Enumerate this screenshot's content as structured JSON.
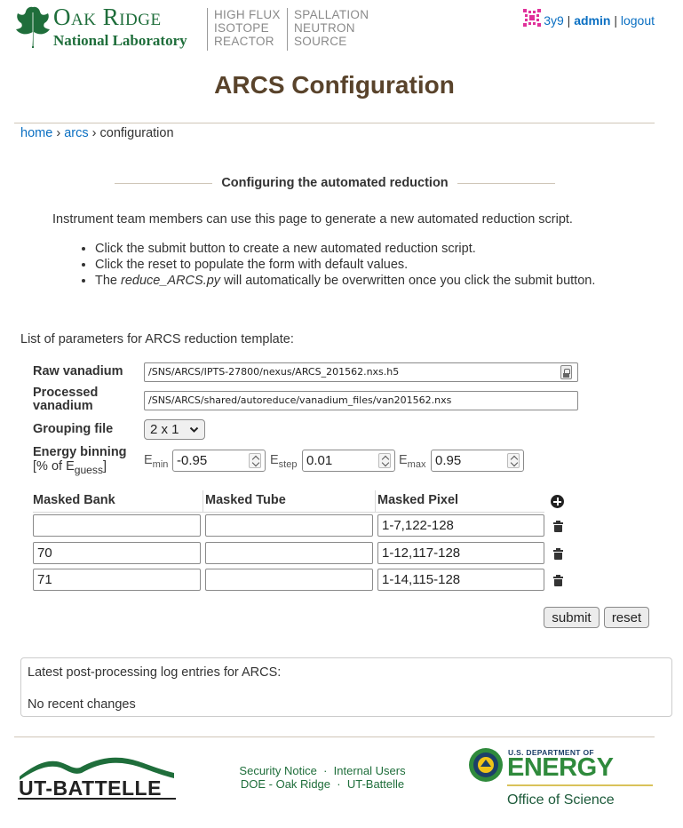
{
  "header": {
    "ornl_name_line1": "Oak Ridge",
    "ornl_name_line2": "National Laboratory",
    "hfir": [
      "HIGH FLUX",
      "ISOTOPE",
      "REACTOR"
    ],
    "sns": [
      "SPALLATION",
      "NEUTRON",
      "SOURCE"
    ],
    "user_id": "3y9",
    "user_separator": "|",
    "admin_label": "admin",
    "logout_label": "logout"
  },
  "page": {
    "title": "ARCS Configuration"
  },
  "breadcrumb": {
    "home": "home",
    "sep1": "›",
    "instrument": "arcs",
    "sep2": "›",
    "current": "configuration"
  },
  "section": {
    "heading": "Configuring the automated reduction",
    "intro": "Instrument team members can use this page to generate a new automated reduction script.",
    "bullet1": "Click the submit button to create a new automated reduction script.",
    "bullet2": "Click the reset to populate the form with default values.",
    "bullet3_prefix": "The ",
    "bullet3_file": "reduce_ARCS.py",
    "bullet3_suffix": " will automatically be overwritten once you click the submit button."
  },
  "params": {
    "heading": "List of parameters for ARCS reduction template:",
    "raw_vanadium_label": "Raw vanadium",
    "raw_vanadium_value": "/SNS/ARCS/IPTS-27800/nexus/ARCS_201562.nxs.h5",
    "processed_vanadium_label_1": "Processed",
    "processed_vanadium_label_2": "vanadium",
    "processed_vanadium_value": "/SNS/ARCS/shared/autoreduce/vanadium_files/van201562.nxs",
    "grouping_label": "Grouping file",
    "grouping_value": "2 x 1",
    "energy_label": "Energy binning",
    "energy_sub_prefix": "[% of E",
    "energy_sub_sub": "guess",
    "energy_sub_suffix": "]",
    "e_letter": "E",
    "emin_sub": "min",
    "emin_value": "-0.95",
    "estep_sub": "step",
    "estep_value": "0.01",
    "emax_sub": "max",
    "emax_value": "0.95"
  },
  "mask": {
    "headers": [
      "Masked Bank",
      "Masked Tube",
      "Masked Pixel"
    ],
    "rows": [
      {
        "bank": "",
        "tube": "",
        "pixel": "1-7,122-128"
      },
      {
        "bank": "70",
        "tube": "",
        "pixel": "1-12,117-128"
      },
      {
        "bank": "71",
        "tube": "",
        "pixel": "1-14,115-128"
      }
    ]
  },
  "buttons": {
    "submit": "submit",
    "reset": "reset"
  },
  "log": {
    "title": "Latest post-processing log entries for ARCS:",
    "empty": "No recent changes"
  },
  "footer": {
    "utb_label": "UT-BATTELLE",
    "security": "Security Notice",
    "internal": "Internal Users",
    "doe_oak_ridge": "DOE - Oak Ridge",
    "ut_battelle": "UT-Battelle",
    "dot": "·",
    "doe_small": "U.S. DEPARTMENT OF",
    "doe_big": "ENERGY",
    "doe_office": "Office of Science"
  },
  "colors": {
    "ornl_green": "#1f6e3b",
    "title_brown": "#59432b",
    "link_blue": "#0a6fc2",
    "doe_green": "#2f8a3c"
  }
}
